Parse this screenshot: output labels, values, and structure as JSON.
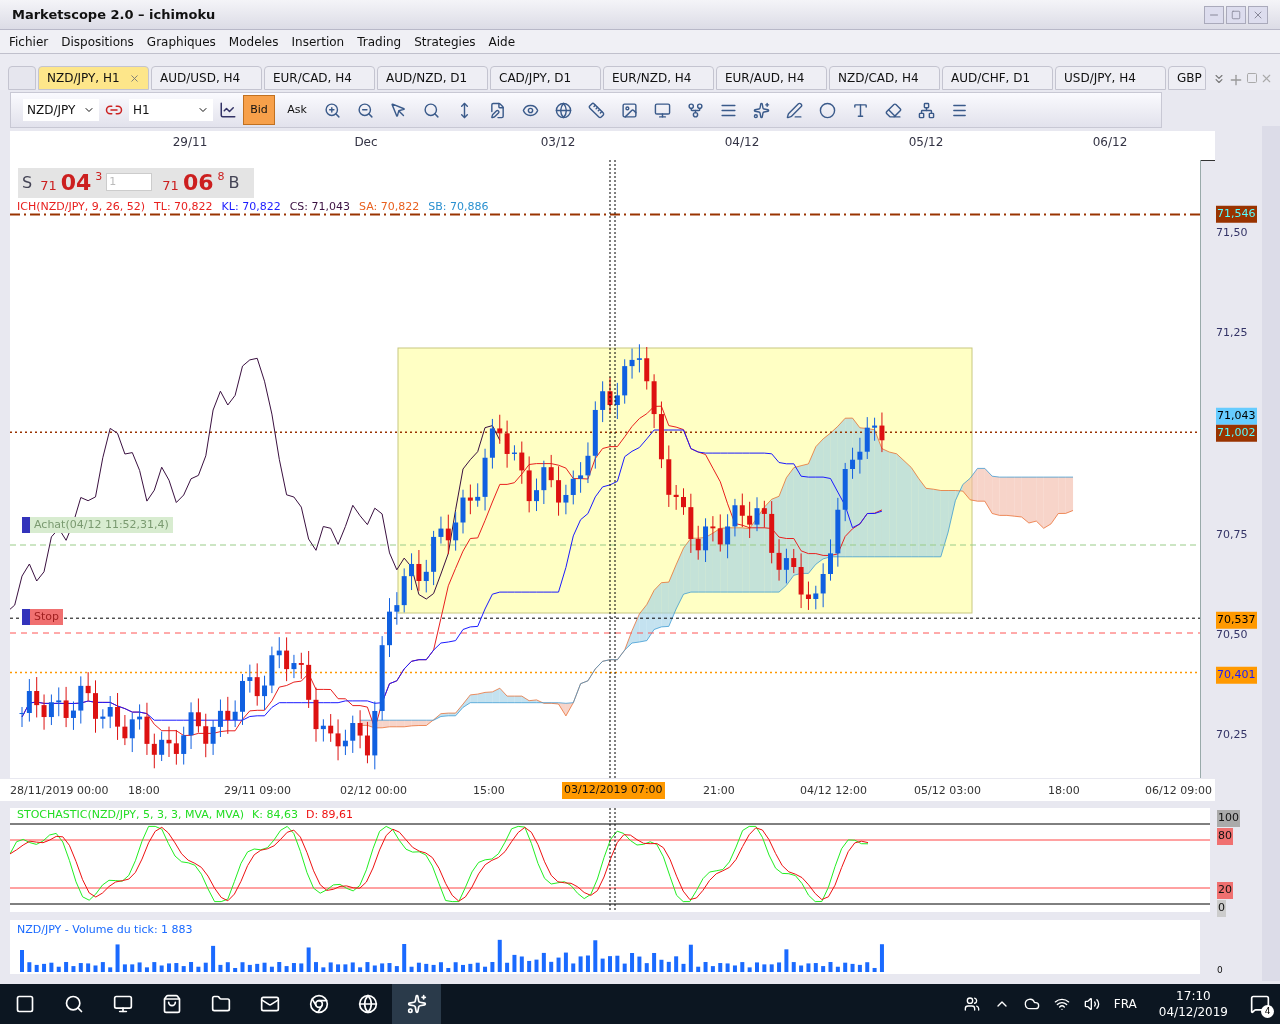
{
  "window": {
    "title": "Marketscope 2.0 – ichimoku"
  },
  "menu": [
    "Fichier",
    "Dispositions",
    "Graphiques",
    "Modeles",
    "Insertion",
    "Trading",
    "Strategies",
    "Aide"
  ],
  "tabs": [
    {
      "label": "NZD/JPY, H1",
      "selected": true
    },
    {
      "label": "AUD/USD, H4",
      "selected": false
    },
    {
      "label": "EUR/CAD, H4",
      "selected": false
    },
    {
      "label": "AUD/NZD, D1",
      "selected": false
    },
    {
      "label": "CAD/JPY, D1",
      "selected": false
    },
    {
      "label": "EUR/NZD, H4",
      "selected": false
    },
    {
      "label": "EUR/AUD, H4",
      "selected": false
    },
    {
      "label": "NZD/CAD, H4",
      "selected": false
    },
    {
      "label": "AUD/CHF, D1",
      "selected": false
    },
    {
      "label": "USD/JPY, H4",
      "selected": false
    },
    {
      "label": "GBP",
      "selected": false
    }
  ],
  "toolbar": {
    "symbol": "NZD/JPY",
    "timeframe": "H1",
    "price_modes": [
      {
        "label": "Bid",
        "selected": true
      },
      {
        "label": "Ask",
        "selected": false
      }
    ]
  },
  "chart": {
    "date_marks": [
      "29/11",
      "Dec",
      "03/12",
      "04/12",
      "05/12",
      "06/12"
    ],
    "quote": {
      "sell_label": "S",
      "sell_figure": "71",
      "sell_pips": "04",
      "sell_fraction": "3",
      "amount": "1",
      "buy_figure": "71",
      "buy_pips": "06",
      "buy_fraction": "8",
      "buy_label": "B"
    },
    "indicator_legend": [
      {
        "text": "ICH(NZD/JPY, 9, 26, 52)",
        "color": "#e8201e"
      },
      {
        "text": "TL: 70,822",
        "color": "#e8201e"
      },
      {
        "text": "KL: 70,822",
        "color": "#1a1aff"
      },
      {
        "text": "CS: 71,043",
        "color": "#3a1040"
      },
      {
        "text": "SA: 70,822",
        "color": "#e8601e"
      },
      {
        "text": "SB: 70,886",
        "color": "#2a90d0"
      }
    ],
    "orders": [
      {
        "label": "Achat(04/12 11:52,31,4)",
        "kind": "entry"
      },
      {
        "label": "Stop",
        "kind": "stop"
      }
    ],
    "price_ticks": [
      "71,50",
      "71,25",
      "70,75",
      "70,50",
      "70,25"
    ],
    "price_markers": [
      {
        "label": "71,546",
        "color": "#993300"
      },
      {
        "label": "71,043",
        "color": "#66ccff"
      },
      {
        "label": "71,002",
        "color": "#993300"
      },
      {
        "label": "70,537",
        "color": "#ff9900"
      },
      {
        "label": "70,401",
        "color": "#ff9900"
      }
    ],
    "time_axis": [
      "28/11/2019 00:00",
      "18:00",
      "29/11 09:00",
      "02/12 00:00",
      "15:00",
      "21:00",
      "04/12 12:00",
      "05/12 03:00",
      "18:00",
      "06/12 09:00"
    ],
    "cursor_time": "03/12/2019 07:00"
  },
  "stochastic": {
    "legend": "STOCHASTIC(NZD/JPY, 5, 3, 3, MVA, MVA)",
    "k": "K: 84,63",
    "d": "D: 89,61",
    "levels": [
      "100",
      "80",
      "20",
      "0"
    ]
  },
  "volume": {
    "legend": "NZD/JPY - Volume du tick: 1 883",
    "axis_label": "0"
  },
  "taskbar": {
    "language": "FRA",
    "time": "17:10",
    "date": "04/12/2019",
    "notifications": "4"
  }
}
